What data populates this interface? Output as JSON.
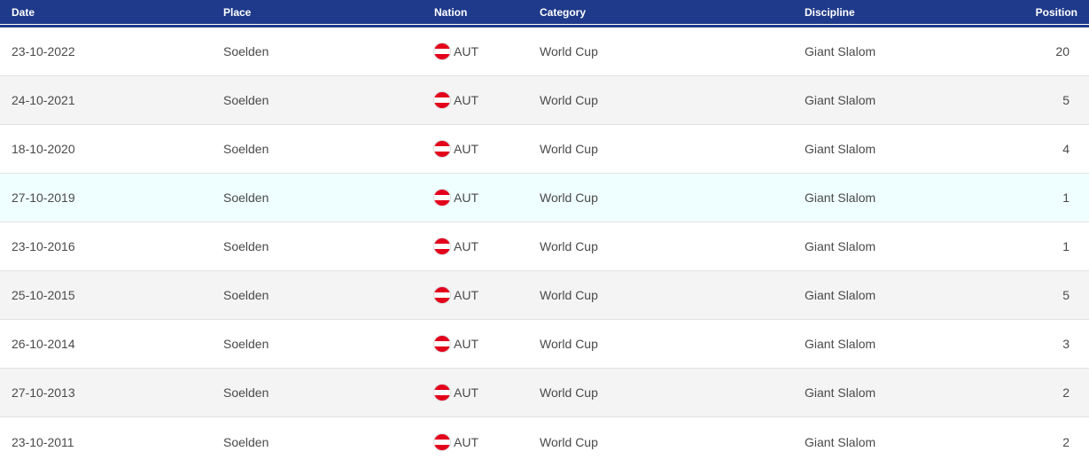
{
  "table": {
    "headers": {
      "date": "Date",
      "place": "Place",
      "nation": "Nation",
      "category": "Category",
      "discipline": "Discipline",
      "position": "Position"
    },
    "rows": [
      {
        "date": "23-10-2022",
        "place": "Soelden",
        "nation": "AUT",
        "category": "World Cup",
        "discipline": "Giant Slalom",
        "position": "20"
      },
      {
        "date": "24-10-2021",
        "place": "Soelden",
        "nation": "AUT",
        "category": "World Cup",
        "discipline": "Giant Slalom",
        "position": "5"
      },
      {
        "date": "18-10-2020",
        "place": "Soelden",
        "nation": "AUT",
        "category": "World Cup",
        "discipline": "Giant Slalom",
        "position": "4"
      },
      {
        "date": "27-10-2019",
        "place": "Soelden",
        "nation": "AUT",
        "category": "World Cup",
        "discipline": "Giant Slalom",
        "position": "1"
      },
      {
        "date": "23-10-2016",
        "place": "Soelden",
        "nation": "AUT",
        "category": "World Cup",
        "discipline": "Giant Slalom",
        "position": "1"
      },
      {
        "date": "25-10-2015",
        "place": "Soelden",
        "nation": "AUT",
        "category": "World Cup",
        "discipline": "Giant Slalom",
        "position": "5"
      },
      {
        "date": "26-10-2014",
        "place": "Soelden",
        "nation": "AUT",
        "category": "World Cup",
        "discipline": "Giant Slalom",
        "position": "3"
      },
      {
        "date": "27-10-2013",
        "place": "Soelden",
        "nation": "AUT",
        "category": "World Cup",
        "discipline": "Giant Slalom",
        "position": "2"
      },
      {
        "date": "23-10-2011",
        "place": "Soelden",
        "nation": "AUT",
        "category": "World Cup",
        "discipline": "Giant Slalom",
        "position": "2"
      }
    ]
  },
  "icons": {
    "nation_flag": "austria-flag-icon"
  },
  "colors": {
    "header_bg": "#1f3a8a",
    "alt_row_bg": "#f4f4f4",
    "highlight_row_bg": "#effefe",
    "flag_red": "#e3001b"
  }
}
